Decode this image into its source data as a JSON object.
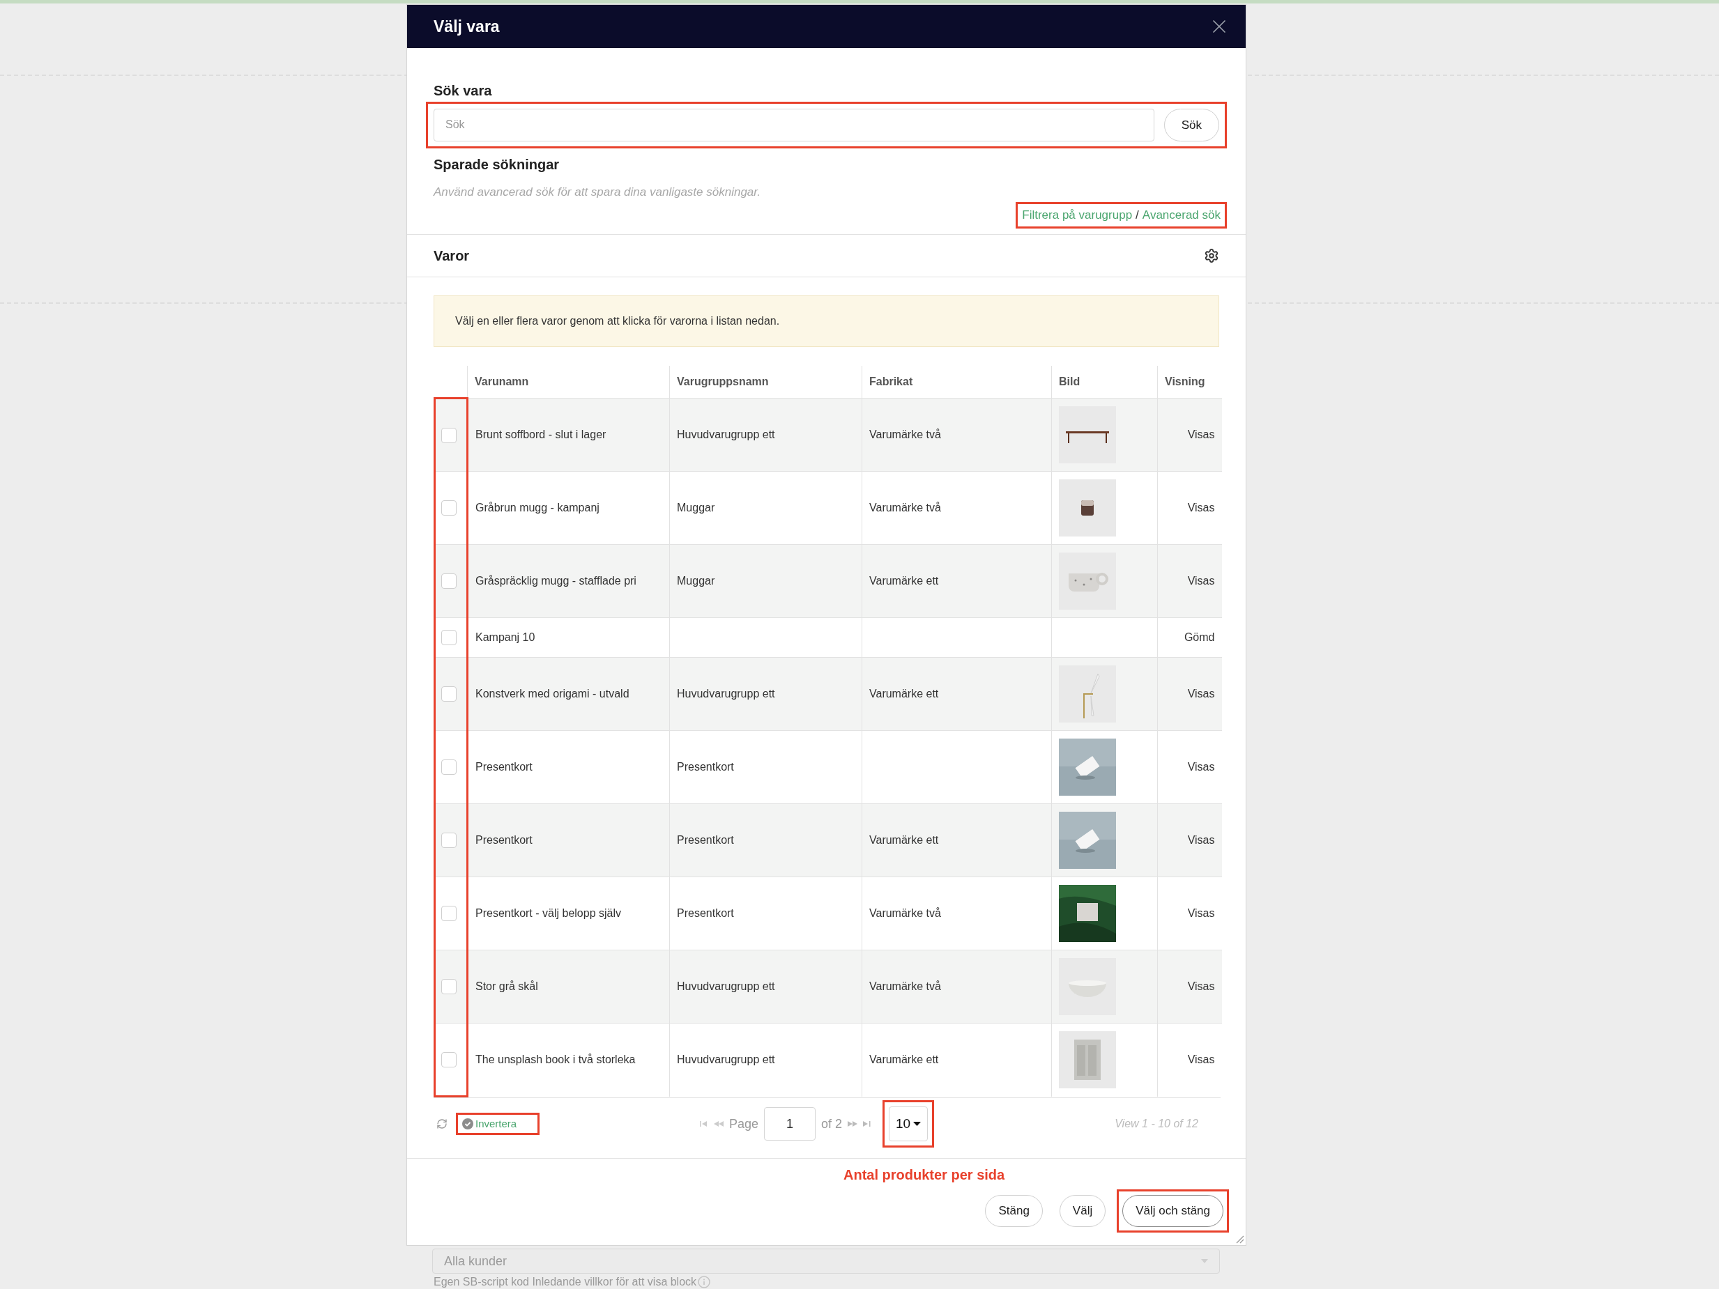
{
  "dialog": {
    "title": "Välj vara"
  },
  "search": {
    "label": "Sök vara",
    "placeholder": "Sök",
    "button": "Sök",
    "highlight": true
  },
  "saved_searches": {
    "title": "Sparade sökningar",
    "hint": "Använd avancerad sök för att spara dina vanligaste sökningar."
  },
  "links": {
    "items": [
      "Filtrera på varugrupp",
      "Avancerad sök"
    ],
    "separator": "/",
    "highlight": true
  },
  "products": {
    "title": "Varor",
    "notice": "Välj en eller flera varor genom att klicka för varorna i listan nedan.",
    "columns": [
      "Varunamn",
      "Varugruppsnamn",
      "Fabrikat",
      "Bild",
      "Visning"
    ],
    "checkbox_highlight": true,
    "rows": [
      {
        "name": "Brunt soffbord - slut i lager",
        "group": "Huvudvarugrupp ett",
        "brand": "Varumärke två",
        "visibility": "Visas",
        "checked": false
      },
      {
        "name": "Gråbrun mugg - kampanj",
        "group": "Muggar",
        "brand": "Varumärke två",
        "visibility": "Visas",
        "checked": false
      },
      {
        "name": "Gråspräcklig mugg - stafflade pri",
        "group": "Muggar",
        "brand": "Varumärke ett",
        "visibility": "Visas",
        "checked": false
      },
      {
        "name": "Kampanj 10",
        "visibility": "Gömd",
        "checked": false
      },
      {
        "name": "Konstverk med origami - utvald",
        "group": "Huvudvarugrupp ett",
        "brand": "Varumärke ett",
        "visibility": "Visas",
        "checked": false
      },
      {
        "name": "Presentkort",
        "group": "Presentkort",
        "visibility": "Visas",
        "checked": false
      },
      {
        "name": "Presentkort",
        "group": "Presentkort",
        "brand": "Varumärke ett",
        "visibility": "Visas",
        "checked": false
      },
      {
        "name": "Presentkort - välj belopp själv",
        "group": "Presentkort",
        "brand": "Varumärke två",
        "visibility": "Visas",
        "checked": false
      },
      {
        "name": "Stor grå skål",
        "group": "Huvudvarugrupp ett",
        "brand": "Varumärke två",
        "visibility": "Visas",
        "checked": false
      },
      {
        "name": "The unsplash book i två storleka",
        "group": "Huvudvarugrupp ett",
        "brand": "Varumärke ett",
        "visibility": "Visas",
        "checked": false
      }
    ]
  },
  "pager": {
    "invert": {
      "label": "Invertera",
      "highlight": true
    },
    "page_label": "Page",
    "page": "1",
    "of": "of 2",
    "page_size": "10",
    "page_size_highlight": true,
    "view": "View 1 - 10 of 12"
  },
  "annotation": "Antal produkter per sida",
  "buttons": [
    {
      "label": "Stäng",
      "highlight": false
    },
    {
      "label": "Välj",
      "highlight": false
    },
    {
      "label": "Välj och stäng",
      "highlight": true
    }
  ],
  "background": {
    "select_value": "Alla kunder",
    "caption": "Egen SB-script kod Inledande villkor för att visa block"
  }
}
